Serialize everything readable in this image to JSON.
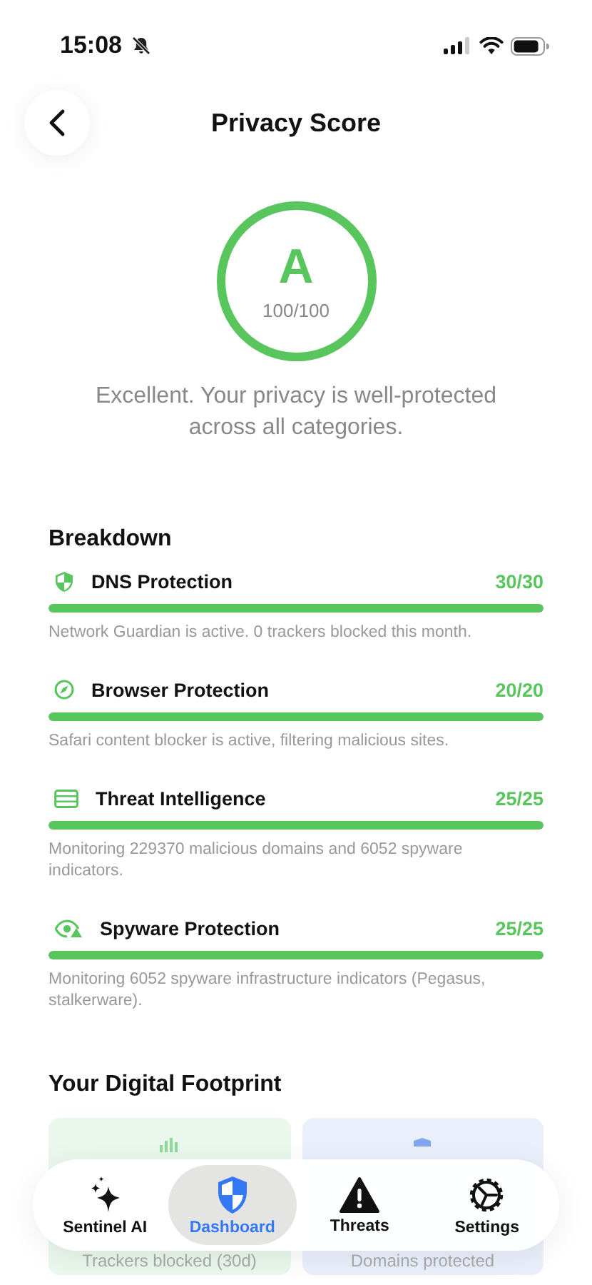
{
  "status_bar": {
    "time": "15:08",
    "silent": true
  },
  "header": {
    "title": "Privacy Score"
  },
  "score": {
    "grade": "A",
    "points": "100/100",
    "level": 1,
    "summary": "Excellent. Your privacy is well-protected across all categories."
  },
  "breakdown": {
    "title": "Breakdown",
    "items": [
      {
        "kind": "shield",
        "name": "DNS Protection",
        "score": "30/30",
        "level": 1,
        "description": "Network Guardian is active. 0 trackers blocked this month."
      },
      {
        "kind": "compass",
        "name": "Browser Protection",
        "score": "20/20",
        "level": 1,
        "description": "Safari content blocker is active, filtering malicious sites."
      },
      {
        "kind": "server",
        "name": "Threat Intelligence",
        "score": "25/25",
        "level": 1,
        "description": "Monitoring 229370 malicious domains and 6052 spyware indicators."
      },
      {
        "kind": "eye",
        "name": "Spyware Protection",
        "score": "25/25",
        "level": 1,
        "description": "Monitoring 6052 spyware infrastructure indicators (Pegasus, stalkerware)."
      }
    ]
  },
  "footprint": {
    "title": "Your Digital Footprint",
    "cards": [
      {
        "kind": "chart",
        "label": "Trackers blocked (30d)",
        "color": "#e9f7ec"
      },
      {
        "kind": "shield",
        "label": "Domains protected",
        "color": "#eaf0fb"
      }
    ]
  },
  "tab_bar": [
    {
      "kind": "sparkles",
      "label": "Sentinel AI",
      "selected": false
    },
    {
      "kind": "shield",
      "label": "Dashboard",
      "selected": true
    },
    {
      "kind": "warning",
      "label": "Threats",
      "selected": false
    },
    {
      "kind": "gear",
      "label": "Settings",
      "selected": false
    }
  ]
}
